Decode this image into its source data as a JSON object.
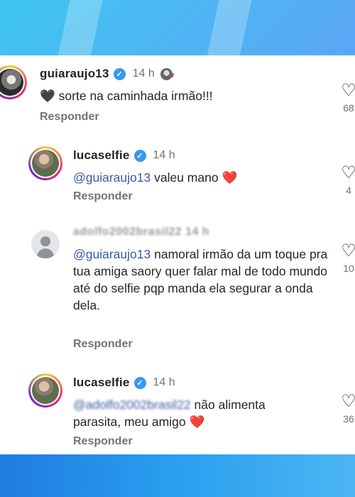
{
  "comments": [
    {
      "username": "guiaraujo13",
      "time": "14 h",
      "text": "sorte na caminhada irmão!!!",
      "lead_emoji": "🖤",
      "reply_label": "Responder",
      "likes": "68"
    },
    {
      "username": "lucaselfie",
      "time": "14 h",
      "mention": "@guiaraujo13",
      "text": "valeu mano",
      "trail_emoji": "❤️",
      "reply_label": "Responder",
      "likes": "4"
    },
    {
      "username": "adolfo2002brasil22 14 h",
      "mention": "@guiaraujo13",
      "text": "namoral irmão da um toque pra tua amiga saory quer falar mal de todo mundo até do selfie pqp manda ela segurar a onda dela.",
      "reply_label": "Responder",
      "likes": "10"
    },
    {
      "username": "lucaselfie",
      "time": "14 h",
      "mention": "@adolfo2002brasil22",
      "text": "não alimenta parasita, meu amigo",
      "trail_emoji": "❤️",
      "reply_label": "Responder",
      "likes": "36"
    }
  ],
  "icons": {
    "verified": "verified-badge-icon",
    "like": "heart-outline-icon"
  },
  "colors": {
    "verified": "#3897f0",
    "mention": "#3b5ba5",
    "heart": "#ed4956"
  }
}
